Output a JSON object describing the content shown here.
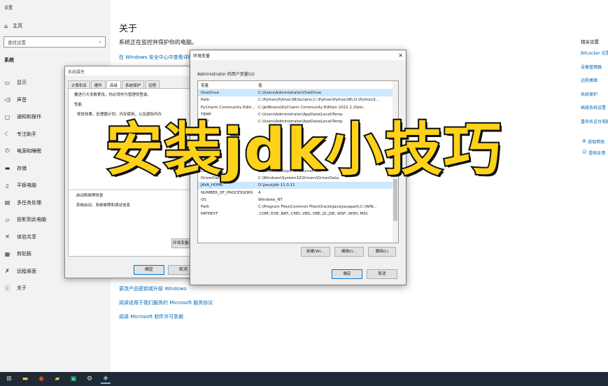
{
  "settings": {
    "window_title": "设置",
    "home": "主页",
    "search_placeholder": "查找设置",
    "section": "系统",
    "items": [
      {
        "label": "显示",
        "icon": "display-icon"
      },
      {
        "label": "声音",
        "icon": "sound-icon"
      },
      {
        "label": "通知和操作",
        "icon": "notification-icon"
      },
      {
        "label": "专注助手",
        "icon": "moon-icon"
      },
      {
        "label": "电源和睡眠",
        "icon": "power-icon"
      },
      {
        "label": "存储",
        "icon": "storage-icon"
      },
      {
        "label": "平板电脑",
        "icon": "tablet-icon"
      },
      {
        "label": "多任务处理",
        "icon": "multitask-icon"
      },
      {
        "label": "投影到此电脑",
        "icon": "projector-icon"
      },
      {
        "label": "体验共享",
        "icon": "share-icon"
      },
      {
        "label": "剪贴板",
        "icon": "clipboard-icon"
      },
      {
        "label": "远程桌面",
        "icon": "remote-icon"
      },
      {
        "label": "关于",
        "icon": "info-icon"
      }
    ]
  },
  "main": {
    "title": "关于",
    "subtitle": "系统正在监控并保护你的电脑。",
    "security_link": "在 Windows 安全中心中查看详细信息",
    "bottom_links": [
      "更改产品密钥或升级 Windows",
      "阅读适用于我们服务的 Microsoft 服务协议",
      "阅读 Microsoft 软件许可条款"
    ]
  },
  "related": {
    "heading": "相关设置",
    "links": [
      "BitLocker 设置",
      "设备管理器",
      "远程桌面",
      "系统保护",
      "高级系统设置",
      "重命名这台电脑"
    ],
    "extra": [
      "获取帮助",
      "提供反馈"
    ]
  },
  "sysprop": {
    "title": "系统属性",
    "tabs": [
      "计算机名",
      "硬件",
      "高级",
      "系统保护",
      "远程"
    ],
    "line1": "要进行大多数更改，你必须作为管理员登录。",
    "perf_label": "性能",
    "perf_desc": "视觉效果，处理器计划，内存使用，以及虚拟内存",
    "startup_label": "启动和故障恢复",
    "startup_desc": "系统启动、系统故障和调试信息",
    "env_button": "环境变量(N)...",
    "ok": "确定",
    "cancel": "取消"
  },
  "envvar": {
    "title": "环境变量",
    "user_label": "Administrator 的用户变量(U)",
    "col_var": "变量",
    "col_val": "值",
    "user_rows": [
      {
        "name": "OneDrive",
        "value": "C:\\Users\\Administrator\\OneDrive"
      },
      {
        "name": "Path",
        "value": "C:\\Python\\Python38\\Scripts\\;C:\\Python\\Python38\\;D:\\Python3..."
      },
      {
        "name": "PyCharm Community Editi...",
        "value": "C:\\JetBrains\\PyCharm Community Edition 2021.1.2\\bin;"
      },
      {
        "name": "TEMP",
        "value": "C:\\Users\\Administrator\\AppData\\Local\\Temp"
      },
      {
        "name": "TMP",
        "value": "C:\\Users\\Administrator\\AppData\\Local\\Temp"
      }
    ],
    "sys_rows": [
      {
        "name": "ComSpec",
        "value": "C:\\WINDOWS\\system32\\cmd.exe"
      },
      {
        "name": "DriverData",
        "value": "C:\\Windows\\System32\\Drivers\\DriverData"
      },
      {
        "name": "JAVA_HOME",
        "value": "D:\\Java\\jdk-11.0.11"
      },
      {
        "name": "NUMBER_OF_PROCESSORS",
        "value": "4"
      },
      {
        "name": "OS",
        "value": "Windows_NT"
      },
      {
        "name": "Path",
        "value": "C:\\Program Files\\Common Files\\Oracle\\Java\\javapath;C:\\WIN..."
      },
      {
        "name": "PATHEXT",
        "value": ".COM;.EXE;.BAT;.CMD;.VBS;.VBE;.JS;.JSE;.WSF;.WSH;.MSC"
      }
    ],
    "new_button": "新建(W)...",
    "edit_button": "编辑(I)...",
    "delete_button": "删除(L)",
    "ok": "确定",
    "cancel": "取消"
  },
  "overlay": {
    "headline": "安装jdk小技巧"
  },
  "taskbar": {
    "icons": [
      "start-icon",
      "file-explorer-icon",
      "chrome-icon",
      "folder-icon",
      "pycharm-icon",
      "settings-icon",
      "system-properties-icon"
    ]
  }
}
